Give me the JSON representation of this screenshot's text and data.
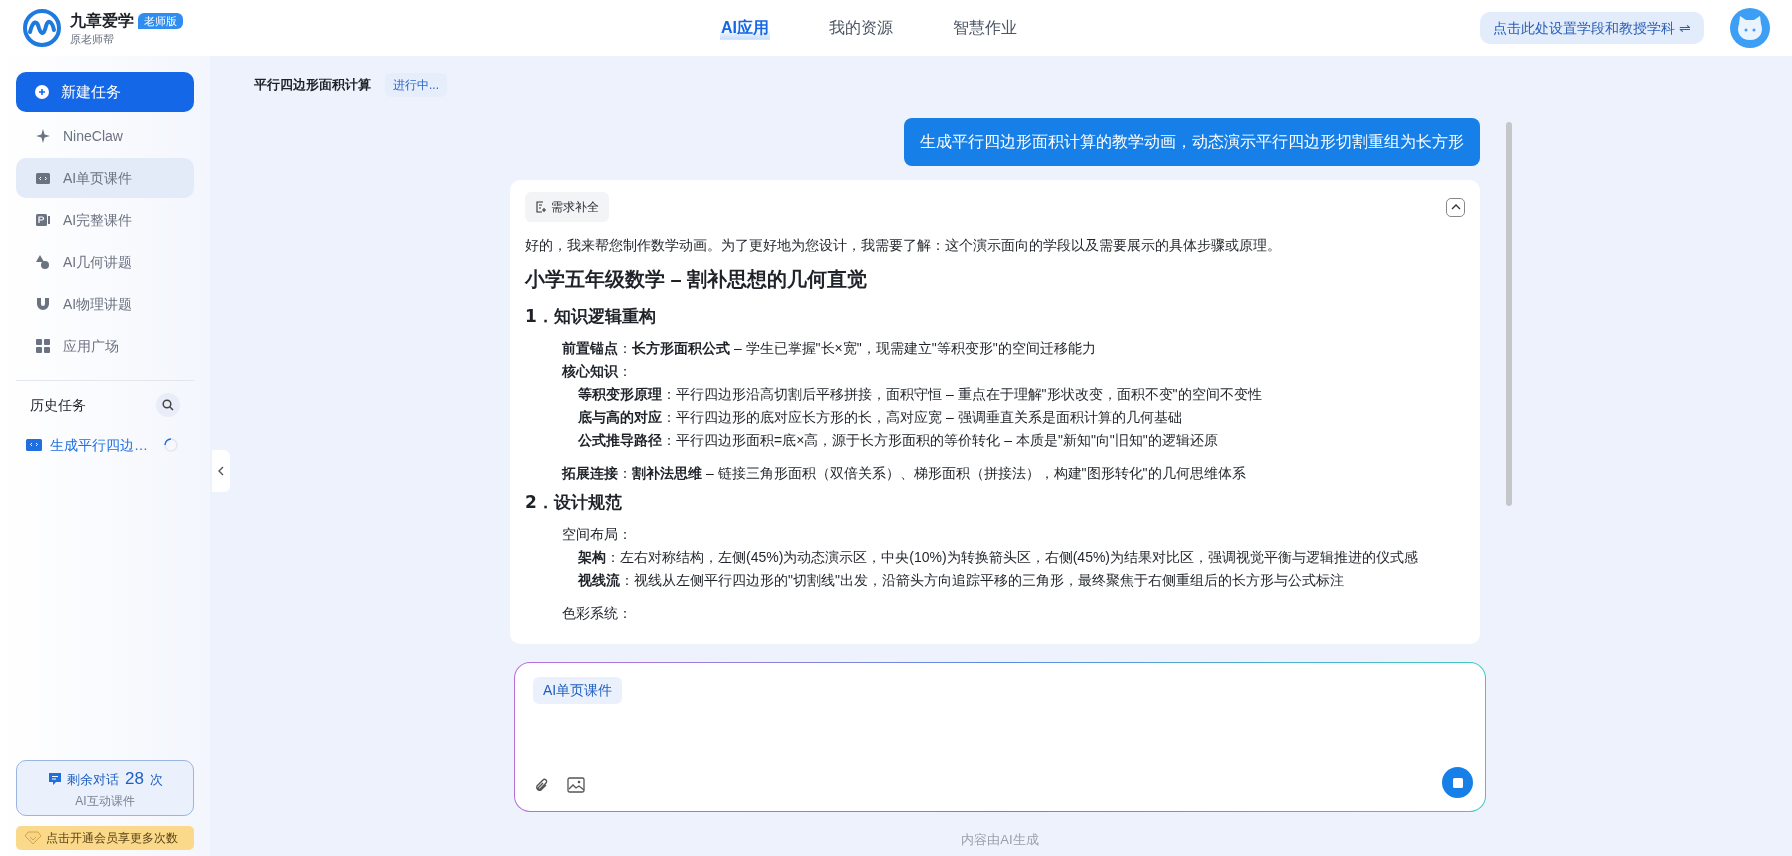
{
  "brand": {
    "name": "九章爱学",
    "badge": "老师版",
    "subtitle": "原老师帮"
  },
  "nav_tabs": [
    {
      "label": "AI应用",
      "selected": true
    },
    {
      "label": "我的资源",
      "selected": false
    },
    {
      "label": "智慧作业",
      "selected": false
    }
  ],
  "settings_button": {
    "label": "点击此处设置学段和教授学科 ⇌"
  },
  "sidebar": {
    "new_task": "新建任务",
    "items": [
      {
        "label": "NineClaw",
        "selected": false
      },
      {
        "label": "AI单页课件",
        "selected": true
      },
      {
        "label": "AI完整课件",
        "selected": false
      },
      {
        "label": "AI几何讲题",
        "selected": false
      },
      {
        "label": "AI物理讲题",
        "selected": false
      },
      {
        "label": "应用广场",
        "selected": false
      }
    ],
    "history_title": "历史任务",
    "history": [
      {
        "label": "生成平行四边…",
        "loading": true
      }
    ],
    "quota": {
      "prefix": "剩余对话",
      "count": "28",
      "suffix": "次",
      "caption": "AI互动课件"
    },
    "vip": "点击开通会员享更多次数"
  },
  "task": {
    "title": "平行四边形面积计算",
    "status": "进行中..."
  },
  "user_message": "生成平行四边形面积计算的教学动画，动态演示平行四边形切割重组为长方形",
  "reply": {
    "chip": "需求补全",
    "expanded": true,
    "blocks": [
      {
        "kind": "paragraph",
        "text": "好的，我来帮您制作数学动画。为了更好地为您设计，我需要了解：这个演示面向的学段以及需要展示的具体步骤或原理。"
      },
      {
        "kind": "heading1",
        "text": "小学五年级数学 – 割补思想的几何直觉"
      },
      {
        "kind": "heading2",
        "text": "1．知识逻辑重构"
      },
      {
        "kind": "line",
        "text": "**前置锚点**：**长方形面积公式** – 学生已掌握\"长×宽\"，现需建立\"等积变形\"的空间迁移能力"
      },
      {
        "kind": "line",
        "text": "**核心知识**：",
        "children": [
          {
            "kind": "line",
            "text": "**等积变形原理**：平行四边形沿高切割后平移拼接，面积守恒 – 重点在于理解\"形状改变，面积不变\"的空间不变性"
          },
          {
            "kind": "line",
            "text": "**底与高的对应**：平行四边形的底对应长方形的长，高对应宽 – 强调垂直关系是面积计算的几何基础"
          },
          {
            "kind": "line",
            "text": "**公式推导路径**：平行四边形面积=底×高，源于长方形面积的等价转化 – 本质是\"新知\"向\"旧知\"的逻辑还原"
          }
        ]
      },
      {
        "kind": "line",
        "text": "**拓展连接**：**割补法思维** – 链接三角形面积（双倍关系）、梯形面积（拼接法），构建\"图形转化\"的几何思维体系"
      },
      {
        "kind": "heading2",
        "text": "2．设计规范"
      },
      {
        "kind": "line",
        "text": "空间布局：",
        "children": [
          {
            "kind": "line",
            "text": "**架构**：左右对称结构，左侧(45%)为动态演示区，中央(10%)为转换箭头区，右侧(45%)为结果对比区，强调视觉平衡与逻辑推进的仪式感"
          },
          {
            "kind": "line",
            "text": "**视线流**：视线从左侧平行四边形的\"切割线\"出发，沿箭头方向追踪平移的三角形，最终聚焦于右侧重组后的长方形与公式标注"
          }
        ]
      },
      {
        "kind": "line",
        "text": "色彩系统："
      }
    ]
  },
  "composer": {
    "tag": "AI单页课件",
    "generating": true
  },
  "footer": "内容由AI生成"
}
